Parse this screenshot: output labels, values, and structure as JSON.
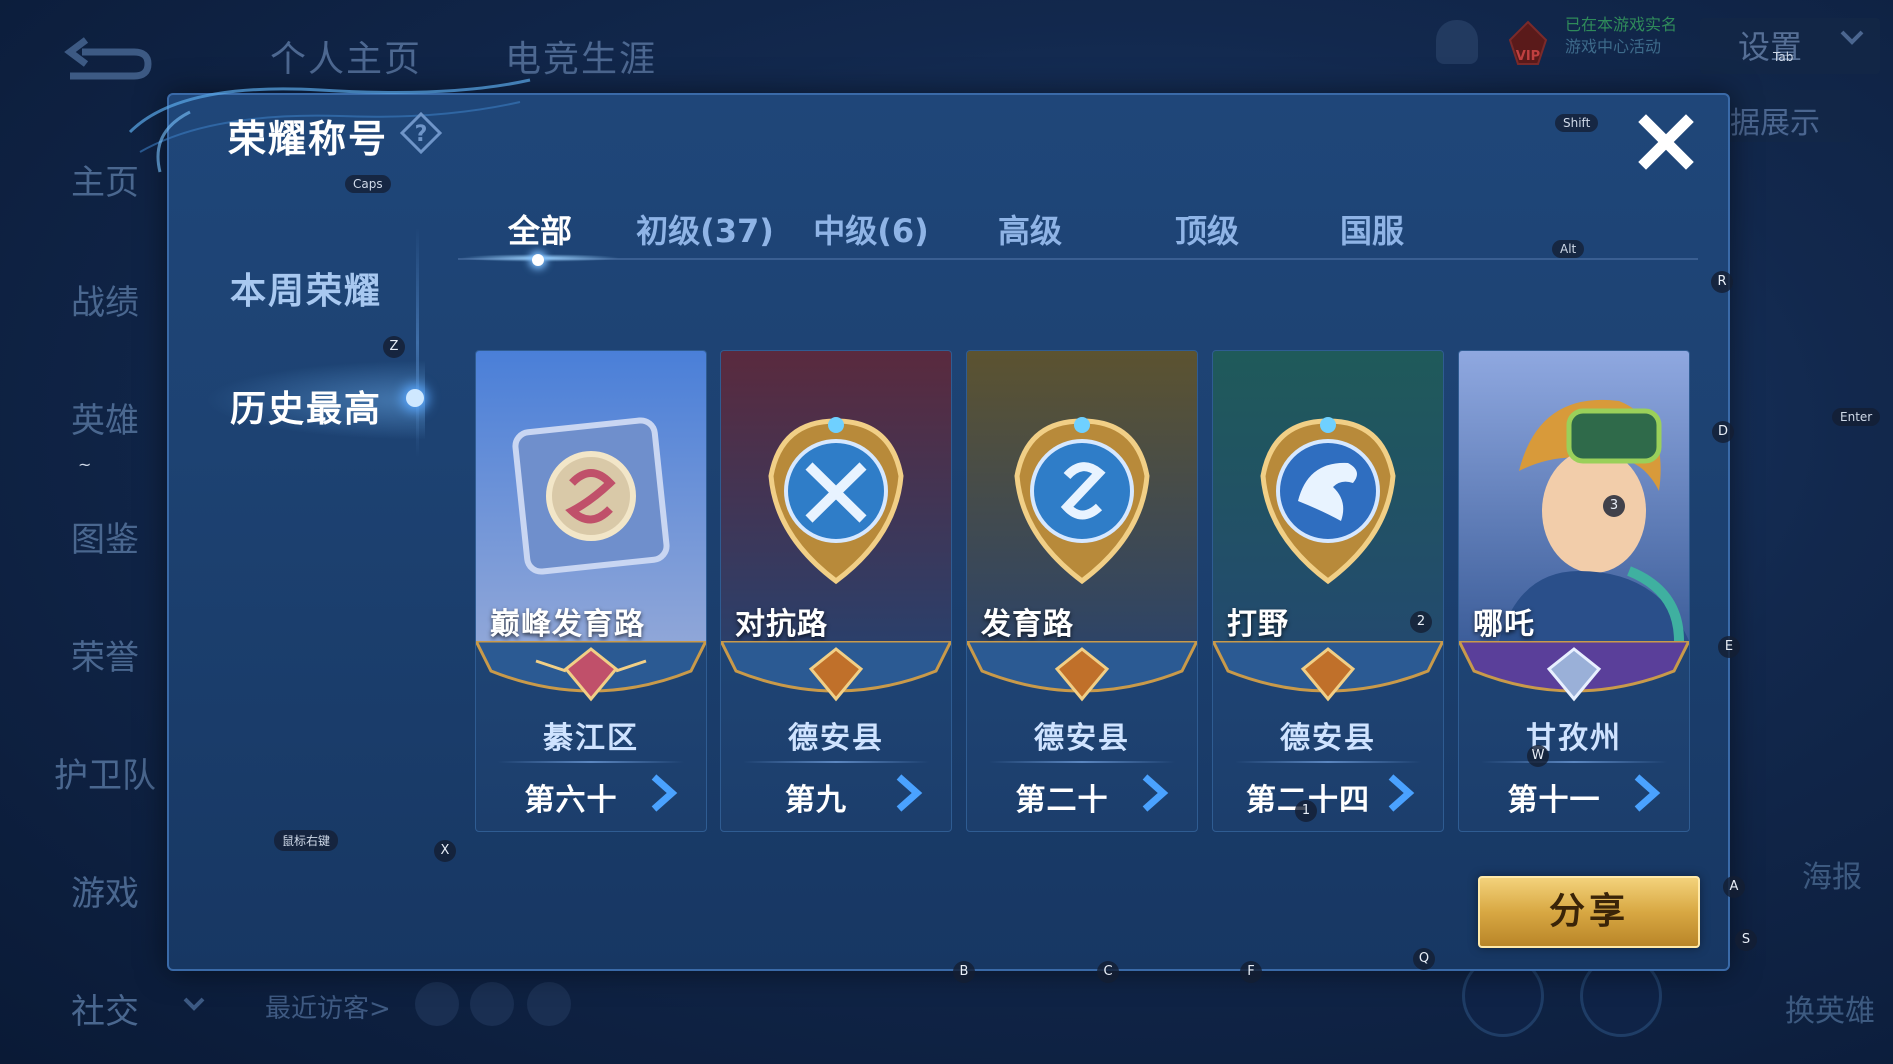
{
  "top_nav": {
    "tabs": [
      "个人主页",
      "电竞生涯"
    ],
    "settings": "设置",
    "data_display": "据展示",
    "realname_line1": "已在本游戏实名",
    "realname_line2": "游戏中心活动"
  },
  "left_menu": [
    "主页",
    "战绩",
    "英雄",
    "图鉴",
    "荣誉",
    "护卫队",
    "游戏",
    "社交"
  ],
  "bottom_bar": {
    "recent_visitors": "最近访客>",
    "poster": "海报",
    "swap_hero": "换英雄"
  },
  "dialog": {
    "title": "荣耀称号",
    "sub_nav": [
      "本周荣耀",
      "历史最高"
    ],
    "sub_nav_active": 1,
    "tabs": [
      "全部",
      "初级(37)",
      "中级(6)",
      "高级",
      "顶级",
      "国服"
    ],
    "active_tab": 0,
    "cards": [
      {
        "name": "巅峰发育路",
        "region": "綦江区",
        "rank": "第六十"
      },
      {
        "name": "对抗路",
        "region": "德安县",
        "rank": "第九"
      },
      {
        "name": "发育路",
        "region": "德安县",
        "rank": "第二十"
      },
      {
        "name": "打野",
        "region": "德安县",
        "rank": "第二十四"
      },
      {
        "name": "哪吒",
        "region": "甘孜州",
        "rank": "第十一"
      }
    ],
    "share": "分享"
  },
  "key_hints": {
    "caps": "Caps",
    "shift": "Shift",
    "alt": "Alt",
    "tab": "Tab",
    "enter": "Enter",
    "z": "Z",
    "r": "R",
    "d": "D",
    "e": "E",
    "a": "A",
    "s": "S",
    "x": "X",
    "b": "B",
    "c": "C",
    "f": "F",
    "q": "Q",
    "w": "W",
    "n1": "1",
    "n2": "2",
    "n3": "3",
    "tilde": "~",
    "mouse_right": "鼠标右键"
  },
  "colors": {
    "accent_gold": "#d8a843",
    "dialog_blue": "#1f4679",
    "active_glow": "#5aa8ff"
  }
}
